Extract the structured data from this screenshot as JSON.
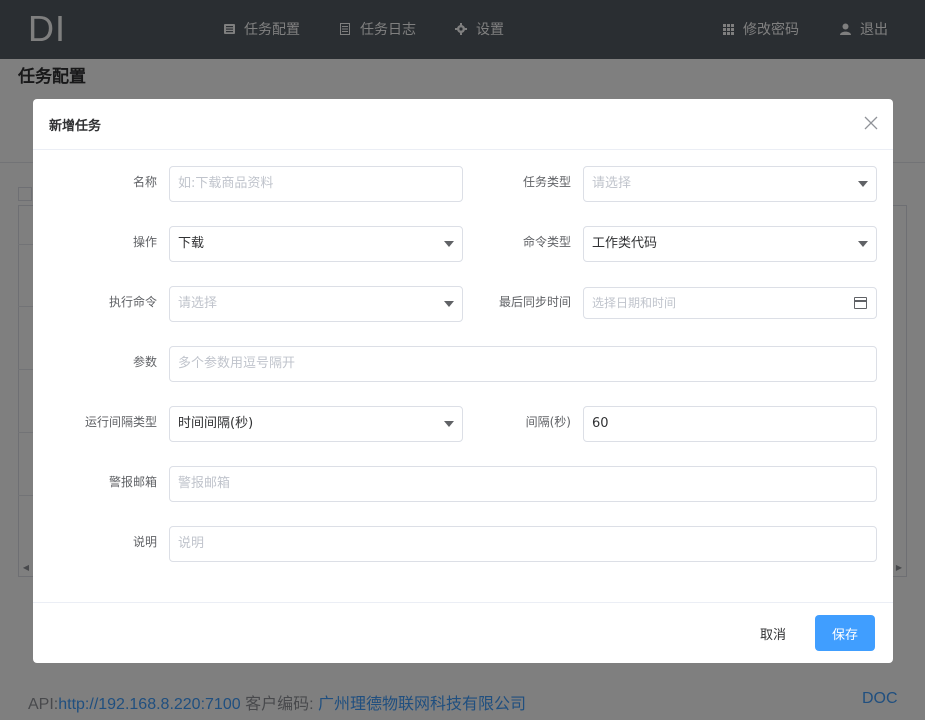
{
  "app": {
    "logo": "DI",
    "nav": [
      {
        "label": "任务配置",
        "icon": "list-icon"
      },
      {
        "label": "任务日志",
        "icon": "document-icon"
      },
      {
        "label": "设置",
        "icon": "gear-icon"
      }
    ],
    "right_nav": [
      {
        "label": "修改密码",
        "icon": "grid-icon"
      },
      {
        "label": "退出",
        "icon": "user-icon"
      }
    ]
  },
  "page": {
    "title": "任务配置"
  },
  "footer": {
    "api_label": "API:",
    "api_url": "http://192.168.8.220:7100",
    "customer_label": "客户编码:",
    "customer_name": "广州理德物联网科技有限公司",
    "doc_link": "DOC"
  },
  "dialog": {
    "title": "新增任务",
    "fields": {
      "name": {
        "label": "名称",
        "placeholder": "如:下载商品资料"
      },
      "task_type": {
        "label": "任务类型",
        "placeholder": "请选择"
      },
      "operation": {
        "label": "操作",
        "value": "下载"
      },
      "command_type": {
        "label": "命令类型",
        "value": "工作类代码"
      },
      "exec_command": {
        "label": "执行命令",
        "placeholder": "请选择"
      },
      "last_sync": {
        "label": "最后同步时间",
        "placeholder": "选择日期和时间"
      },
      "params": {
        "label": "参数",
        "placeholder": "多个参数用逗号隔开"
      },
      "interval_type": {
        "label": "运行间隔类型",
        "value": "时间间隔(秒)"
      },
      "interval": {
        "label": "间隔(秒)",
        "value": "60"
      },
      "alert_email": {
        "label": "警报邮箱",
        "placeholder": "警报邮箱"
      },
      "description": {
        "label": "说明",
        "placeholder": "说明"
      }
    },
    "cancel_label": "取消",
    "save_label": "保存"
  },
  "colors": {
    "topbar": "#545c64",
    "primary": "#409eff",
    "overlay": "rgba(0,0,0,0.5)"
  }
}
